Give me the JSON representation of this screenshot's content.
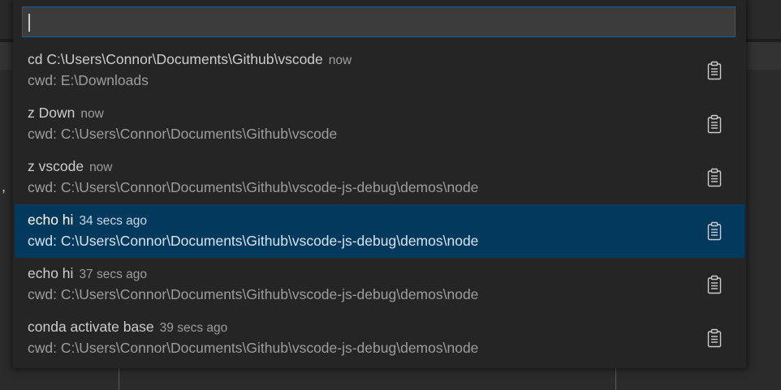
{
  "quick_pick": {
    "input_value": "",
    "items": [
      {
        "label": "cd C:\\Users\\Connor\\Documents\\Github\\vscode",
        "description": "now",
        "detail": "cwd: E:\\Downloads",
        "selected": false,
        "icon": "clipboard-icon"
      },
      {
        "label": "z Down",
        "description": "now",
        "detail": "cwd: C:\\Users\\Connor\\Documents\\Github\\vscode",
        "selected": false,
        "icon": "clipboard-icon"
      },
      {
        "label": "z vscode",
        "description": "now",
        "detail": "cwd: C:\\Users\\Connor\\Documents\\Github\\vscode-js-debug\\demos\\node",
        "selected": false,
        "icon": "clipboard-icon"
      },
      {
        "label": "echo hi",
        "description": "34 secs ago",
        "detail": "cwd: C:\\Users\\Connor\\Documents\\Github\\vscode-js-debug\\demos\\node",
        "selected": true,
        "icon": "clipboard-icon"
      },
      {
        "label": "echo hi",
        "description": "37 secs ago",
        "detail": "cwd: C:\\Users\\Connor\\Documents\\Github\\vscode-js-debug\\demos\\node",
        "selected": false,
        "icon": "clipboard-icon"
      },
      {
        "label": "conda activate base",
        "description": "39 secs ago",
        "detail": "cwd: C:\\Users\\Connor\\Documents\\Github\\vscode-js-debug\\demos\\node",
        "selected": false,
        "icon": "clipboard-icon"
      }
    ]
  },
  "background": {
    "stray_text": ","
  },
  "colors": {
    "selection": "#04395e",
    "focus_border": "#0e639c",
    "widget_bg": "#252526"
  }
}
